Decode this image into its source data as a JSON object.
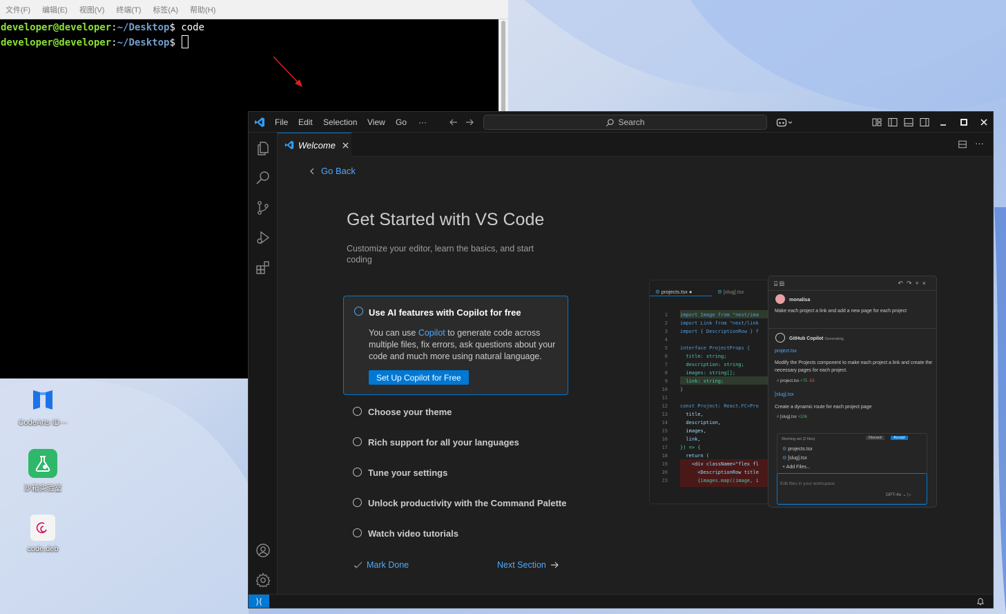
{
  "colors": {
    "accent": "#0078d4",
    "link": "#4daafc",
    "terminal_user": "#8ae234",
    "terminal_path": "#729fcf"
  },
  "terminal": {
    "menu": [
      "文件(F)",
      "编辑(E)",
      "视图(V)",
      "终端(T)",
      "标签(A)",
      "帮助(H)"
    ],
    "lines": [
      {
        "user": "developer@developer",
        "sep": ":",
        "path": "~/Desktop",
        "prompt": "$ ",
        "cmd": "code"
      },
      {
        "user": "developer@developer",
        "sep": ":",
        "path": "~/Desktop",
        "prompt": "$ ",
        "cmd": ""
      }
    ]
  },
  "desktop": {
    "icons": [
      {
        "label": "CodeArts ID···",
        "icon": "codearts-icon"
      },
      {
        "label": "沙箱实验室",
        "icon": "sandbox-lab-icon"
      },
      {
        "label": "code.deb",
        "icon": "deb-package-icon"
      }
    ]
  },
  "vscode": {
    "menu": [
      "File",
      "Edit",
      "Selection",
      "View",
      "Go",
      "···"
    ],
    "search_label": "Search",
    "tab": {
      "label": "Welcome"
    },
    "welcome": {
      "go_back": "Go Back",
      "title": "Get Started with VS Code",
      "subtitle": "Customize your editor, learn the basics, and start coding",
      "active_step": {
        "title": "Use AI features with Copilot for free",
        "desc_prefix": "You can use ",
        "desc_link": "Copilot",
        "desc_suffix": " to generate code across multiple files, fix errors, ask questions about your code and much more using natural language.",
        "button": "Set Up Copilot for Free"
      },
      "steps": [
        "Choose your theme",
        "Rich support for all your languages",
        "Tune your settings",
        "Unlock productivity with the Command Palette",
        "Watch video tutorials"
      ],
      "mark_done": "Mark Done",
      "next_section": "Next Section"
    },
    "preview": {
      "tabs": [
        "projects.tsx",
        "[slug].tsx"
      ],
      "code_lines": [
        {
          "n": "1",
          "t": "import Image from \"next/ima"
        },
        {
          "n": "2",
          "t": "import Link from \"next/link"
        },
        {
          "n": "3",
          "t": "import { DescriptionRow } f"
        },
        {
          "n": "4",
          "t": ""
        },
        {
          "n": "5",
          "t": "interface ProjectProps {"
        },
        {
          "n": "6",
          "t": "  title: string;"
        },
        {
          "n": "7",
          "t": "  description: string;"
        },
        {
          "n": "8",
          "t": "  images: string[];"
        },
        {
          "n": "9",
          "t": "  link: string;"
        },
        {
          "n": "10",
          "t": "}"
        },
        {
          "n": "11",
          "t": ""
        },
        {
          "n": "12",
          "t": "const Project: React.FC<Pro"
        },
        {
          "n": "13",
          "t": "  title,"
        },
        {
          "n": "14",
          "t": "  description,"
        },
        {
          "n": "15",
          "t": "  images,"
        },
        {
          "n": "16",
          "t": "  link,"
        },
        {
          "n": "17",
          "t": "}) => {"
        },
        {
          "n": "18",
          "t": "  return ("
        },
        {
          "n": "19",
          "t": "    <div className=\"flex fl"
        },
        {
          "n": "20",
          "t": "      <DescriptionRow title"
        },
        {
          "n": "23",
          "t": "      {images.map((image, i"
        }
      ],
      "chat": {
        "user": "monalisa",
        "request": "Make each project a link and add a new page for each project",
        "assistant": "GitHub Copilot",
        "status": "Generating.",
        "file1": "project.tsx",
        "msg1": "Modify the Projects component to make each project a link and create the necessary pages for each project.",
        "chip1": "project.tsx",
        "chip1_add": "+75",
        "chip1_del": "-53",
        "file2": "[slug].tsx",
        "msg2": "Create a dynamic route for each project page",
        "chip2": "[slug].tsx",
        "chip2_add": "+106",
        "working_set": "Working set (2 files)",
        "discard": "Discard",
        "accept": "Accept",
        "ws_files": [
          "projects.tsx",
          "[slug].tsx"
        ],
        "add_files": "Add Files...",
        "input_placeholder": "Edit files in your workspace",
        "model": "GPT-4o"
      }
    }
  }
}
